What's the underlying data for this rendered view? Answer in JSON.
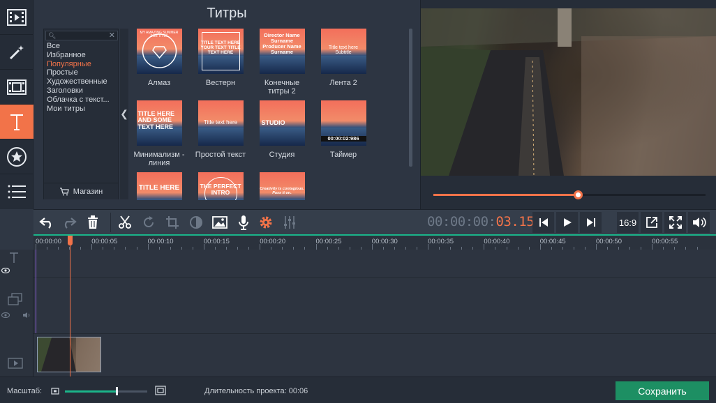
{
  "panel": {
    "title": "Титры",
    "categories": [
      "Все",
      "Избранное",
      "Популярные",
      "Простые",
      "Художественные",
      "Заголовки",
      "Облачка с текст...",
      "Мои титры"
    ],
    "active_category_index": 2,
    "shop_label": "Магазин"
  },
  "tiles": [
    {
      "caption": "Алмаз",
      "thumb_text": "MY AMAZING SUMMER SUB TITLE"
    },
    {
      "caption": "Вестерн",
      "thumb_text": "TITLE TEXT HERE YOUR TEXT TITLE TEXT HERE"
    },
    {
      "caption": "Конечные титры 2",
      "thumb_text": "Director Name Surname Producer Name Surname"
    },
    {
      "caption": "Лента 2",
      "thumb_text": "Title text here Subtitle"
    },
    {
      "caption": "Минимализм - линия",
      "thumb_text": "TITLE HERE AND SOME TEXT HERE"
    },
    {
      "caption": "Простой текст",
      "thumb_text": "Title text here"
    },
    {
      "caption": "Студия",
      "thumb_text": "STUDIO"
    },
    {
      "caption": "Таймер",
      "thumb_text": "00:00:02:986"
    },
    {
      "caption": "",
      "thumb_text": "TITLE HERE"
    },
    {
      "caption": "",
      "thumb_text": "THE PERFECT INTRO"
    },
    {
      "caption": "",
      "thumb_text": "Creativity is contagious. Pass it on."
    }
  ],
  "preview": {
    "progress_fraction": 0.53
  },
  "toolbar": {
    "timecode_dim": "00:00:",
    "timecode_hi": "03.150",
    "aspect_label": "16:9"
  },
  "ruler": {
    "labels": [
      "00:00:00",
      "00:00:05",
      "00:00:10",
      "00:00:15",
      "00:00:20",
      "00:00:25",
      "00:00:30",
      "00:00:35",
      "00:00:40",
      "00:00:45",
      "00:00:50",
      "00:00:55"
    ]
  },
  "bottom": {
    "zoom_label": "Масштаб:",
    "zoom_fraction": 0.63,
    "duration_label": "Длительность проекта:",
    "duration_value": "00:06",
    "save_label": "Сохранить"
  },
  "colors": {
    "accent": "#f27349",
    "green": "#1bb58a",
    "save": "#1d8f63"
  },
  "icons": [
    "film-icon",
    "magic-wand-icon",
    "transitions-icon",
    "text-icon",
    "sticker-star-icon",
    "list-icon",
    "undo-icon",
    "redo-icon",
    "trash-icon",
    "scissors-icon",
    "rotate-icon",
    "crop-icon",
    "color-adjust-icon",
    "image-icon",
    "microphone-icon",
    "gear-icon",
    "equalizer-icon",
    "skip-back-icon",
    "play-icon",
    "skip-forward-icon",
    "export-icon",
    "fullscreen-icon",
    "volume-icon"
  ]
}
